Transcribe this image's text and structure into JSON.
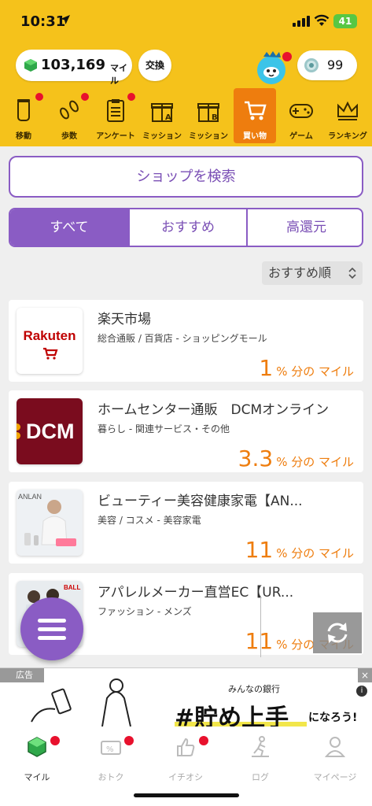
{
  "status_bar": {
    "time": "10:31",
    "battery": "41"
  },
  "header": {
    "miles": "103,169",
    "miles_unit": "マイル",
    "exchange_label": "交換",
    "coin_count": "99"
  },
  "categories": [
    {
      "label": "移動",
      "icon": "jar-icon",
      "dot": true
    },
    {
      "label": "歩数",
      "icon": "footprints-icon",
      "dot": true
    },
    {
      "label": "アンケート",
      "icon": "clipboard-icon",
      "dot": true
    },
    {
      "label": "ミッション",
      "icon": "gift-a-icon",
      "dot": false
    },
    {
      "label": "ミッション",
      "icon": "gift-b-icon",
      "dot": false
    },
    {
      "label": "買い物",
      "icon": "cart-icon",
      "dot": false,
      "active": true
    },
    {
      "label": "ゲーム",
      "icon": "gamepad-icon",
      "dot": false
    },
    {
      "label": "ランキング",
      "icon": "crown-icon",
      "dot": false
    }
  ],
  "search": {
    "label": "ショップを検索"
  },
  "filter_tabs": [
    {
      "label": "すべて",
      "active": true
    },
    {
      "label": "おすすめ",
      "active": false
    },
    {
      "label": "高還元",
      "active": false
    }
  ],
  "sort": {
    "label": "おすすめ順"
  },
  "shops": [
    {
      "name": "楽天市場",
      "category": "総合通販 / 百貨店 - ショッピングモール",
      "reward": "1",
      "reward_unit": "% 分の マイル",
      "logo_text": "Rakuten"
    },
    {
      "name": "ホームセンター通販　DCMオンライン",
      "category": "暮らし - 関連サービス・その他",
      "reward": "3.3",
      "reward_unit": "% 分の マイル",
      "logo_text": "DCM"
    },
    {
      "name": "ビューティー美容健康家電【AN...",
      "category": "美容 / コスメ - 美容家電",
      "reward": "11",
      "reward_unit": "% 分の マイル",
      "logo_text": "ANLAN"
    },
    {
      "name": "アパレルメーカー直営EC【UR...",
      "category": "ファッション - メンズ",
      "reward": "11",
      "reward_unit": "% 分の マイル",
      "logo_text": "BALL"
    }
  ],
  "ad": {
    "label": "広告",
    "close": "×",
    "bank": "みんなの銀行",
    "headline": "#貯め上手",
    "headline_suffix": "になろう!"
  },
  "tabbar": [
    {
      "label": "マイル",
      "icon": "gem-icon",
      "dot": true,
      "active": true
    },
    {
      "label": "おトク",
      "icon": "percent-ticket-icon",
      "dot": true
    },
    {
      "label": "イチオシ",
      "icon": "thumbs-up-icon",
      "dot": true
    },
    {
      "label": "ログ",
      "icon": "runner-icon",
      "dot": false
    },
    {
      "label": "マイページ",
      "icon": "person-icon",
      "dot": false
    }
  ],
  "colors": {
    "header": "#f5c21b",
    "accent_purple": "#8a5cc4",
    "reward_orange": "#ee7d0e",
    "active_tab": "#ee7d0e"
  }
}
